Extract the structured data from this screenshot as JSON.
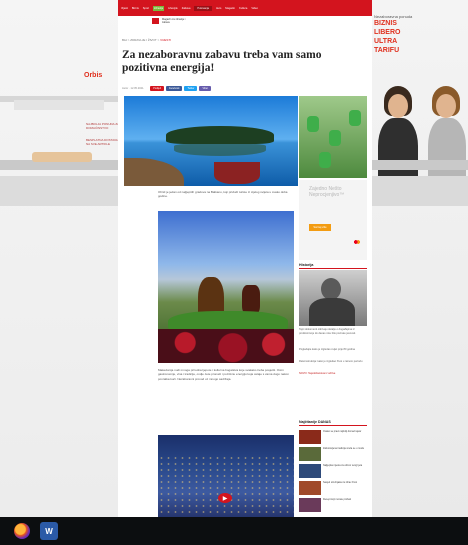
{
  "nav": {
    "items": [
      "Vijesti",
      "Biznis",
      "Sport",
      "Zdravlje",
      "Lifestyle",
      "Zabava",
      "Putovanja",
      "Auto",
      "Magazin",
      "Kultura",
      "Video"
    ],
    "active": "Zdravlje",
    "highlight": "Putovanja"
  },
  "site": {
    "logo_text": "Magazin za zdravlje i zabavu"
  },
  "breadcrumb": {
    "path": "BiH > ZDRAVLJE I ŽIVOT >",
    "category": "VIJESTI"
  },
  "article": {
    "title": "Za nezaboravnu zabavu treba vam samo pozitivna energija!",
    "date": "Autor · 12.05.2021.",
    "share_buttons": [
      "Podijeli",
      "Facebook",
      "Twitter",
      "Viber"
    ],
    "caption": "Ohrid je jedan od najljepših gradova na Balkanu, koji privlači turiste iz cijelog svijeta u svako doba godine.",
    "body": "Makedonija nudi mnoga prirodna ljepote i kulturna bogatstva koje svakako treba posjetiti. Osim gastronomije, vina i tradicije, ovdje ćete pronaći i pozitivnu energiju koja ostaje s vama dugo nakon povratka kući. Nezaboravni provod uz mnogo sadržaja."
  },
  "sidebar": {
    "ad": {
      "title": "Zajedno Nešto Neprocjenjivo™",
      "button": "Saznaj više"
    },
    "section_title": "Historija",
    "story": "Tajni dokumenti otkrivaju detalje o događajima iz prošlosti koje do danas nisu bile poznate javnosti.",
    "links": [
      "Pogledajte kako je izgledao svijet prije 80 godina",
      "Rekonstrukcija: kako je izgledao život u ratnom periodu",
      "NOVO: Svjedočanstva iz arhive"
    ],
    "most_read_title": "Najčitanije DANAS",
    "most_read": [
      "Ovako se pravi najbolji domaći ajvar",
      "Zaboravljena tradicija vraća se u modu",
      "Najljepša mjesta za odmor ovog ljeta",
      "Savjeti stručnjaka za zdrav život",
      "Recept koji morate probati"
    ]
  },
  "left_ad": {
    "brand": "Orbis",
    "note1": "NAJBOLJA PONUDA ZA DOMAĆINSTVO",
    "note2": "BESPLATNA DOSTAVA NA SVE ARTIKLE"
  },
  "right_ad": {
    "small": "Nezaboravna ponuda",
    "lines": [
      "BIZNIS",
      "LIBERO",
      "ULTRA",
      "TARIFU"
    ]
  },
  "taskbar": {
    "apps": [
      "firefox-icon",
      "word-icon"
    ],
    "word_letter": "W"
  },
  "colors": {
    "brand_red": "#d3141e",
    "accent_green": "#7bb83a",
    "ad_orange": "#f39c12"
  }
}
